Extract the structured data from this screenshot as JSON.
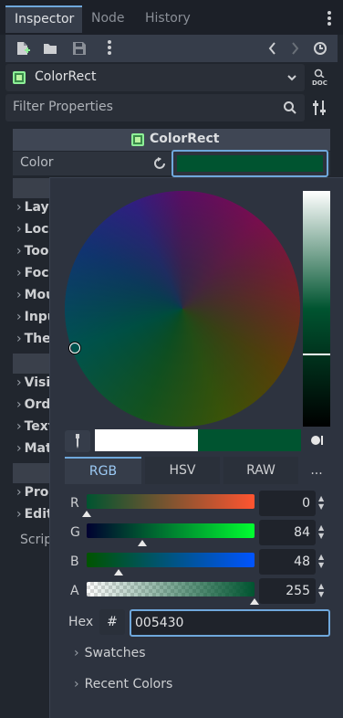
{
  "tabs": [
    {
      "label": "Inspector",
      "active": true
    },
    {
      "label": "Node",
      "active": false
    },
    {
      "label": "History",
      "active": false
    }
  ],
  "toolbar": {
    "icons": [
      "new-resource-icon",
      "load-resource-icon",
      "save-icon",
      "more-menu-icon",
      "history-back-icon",
      "history-forward-icon",
      "object-history-icon"
    ]
  },
  "node_selector": {
    "name": "ColorRect",
    "icon": "color-rect-icon"
  },
  "doc_button": "DOC",
  "filter": {
    "placeholder": "Filter Properties"
  },
  "section": {
    "title": "ColorRect"
  },
  "color_property": {
    "label": "Color",
    "value": "#005430"
  },
  "groups_a": [
    "Layo",
    "Loca",
    "Tool",
    "Focu",
    "Mou",
    "Inpu",
    "Ther"
  ],
  "groups_b": [
    "Visi",
    "Ord",
    "Text",
    "Mat"
  ],
  "groups_c": [
    "Proc",
    "Edit"
  ],
  "script_label": "Scrip",
  "picker": {
    "old_color": "#ffffff",
    "new_color": "#005430",
    "modes": [
      "RGB",
      "HSV",
      "RAW",
      "..."
    ],
    "active_mode": "RGB",
    "channels": [
      {
        "label": "R",
        "value": "0",
        "fraction": 0.0
      },
      {
        "label": "G",
        "value": "84",
        "fraction": 0.33
      },
      {
        "label": "B",
        "value": "48",
        "fraction": 0.19
      },
      {
        "label": "A",
        "value": "255",
        "fraction": 1.0
      }
    ],
    "hex_label": "Hex",
    "hash": "#",
    "hex_value": "005430",
    "swatches_label": "Swatches",
    "recent_label": "Recent Colors"
  }
}
